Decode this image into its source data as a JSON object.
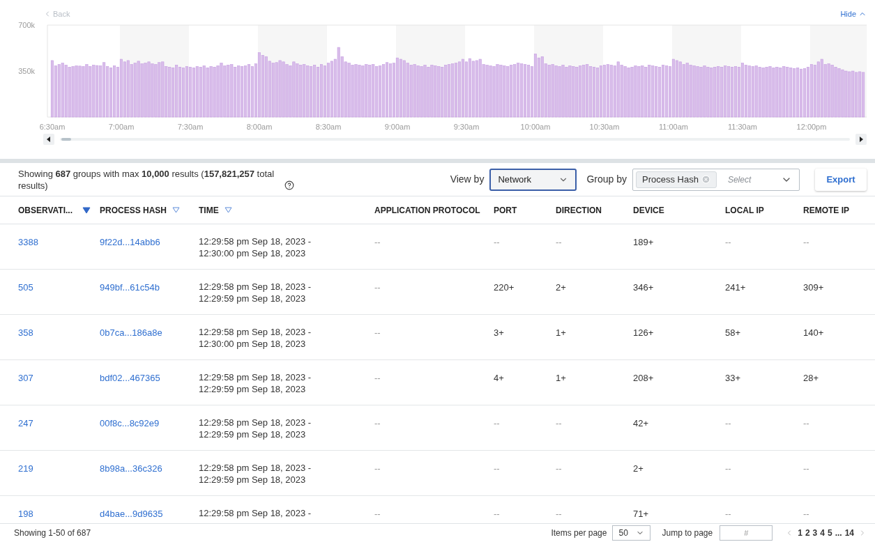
{
  "chart": {
    "back_label": "Back",
    "hide_label": "Hide",
    "chart_data": {
      "type": "bar",
      "ylim": [
        0,
        700
      ],
      "yticks": [
        {
          "value": 350,
          "label": "350k"
        },
        {
          "value": 700,
          "label": "700k"
        }
      ],
      "series": [
        {
          "color": "#d9bdea",
          "values": [
            430,
            390,
            400,
            410,
            395,
            380,
            385,
            390,
            388,
            385,
            400,
            385,
            395,
            392,
            390,
            415,
            385,
            375,
            390,
            380,
            440,
            420,
            430,
            400,
            410,
            425,
            405,
            410,
            420,
            405,
            400,
            415,
            420,
            385,
            380,
            375,
            395,
            380,
            375,
            385,
            380,
            375,
            385,
            380,
            390,
            375,
            385,
            380,
            390,
            410,
            390,
            395,
            400,
            380,
            390,
            385,
            390,
            400,
            385,
            405,
            490,
            470,
            460,
            425,
            410,
            415,
            430,
            420,
            400,
            390,
            420,
            405,
            395,
            400,
            390,
            385,
            395,
            380,
            400,
            390,
            410,
            425,
            440,
            530,
            460,
            420,
            410,
            395,
            400,
            395,
            390,
            400,
            395,
            400,
            385,
            390,
            400,
            415,
            405,
            410,
            450,
            440,
            430,
            410,
            395,
            400,
            390,
            385,
            395,
            380,
            395,
            390,
            385,
            380,
            395,
            400,
            405,
            410,
            420,
            440,
            420,
            445,
            425,
            430,
            440,
            400,
            395,
            390,
            385,
            400,
            395,
            390,
            385,
            395,
            400,
            410,
            405,
            400,
            395,
            385,
            480,
            450,
            460,
            405,
            395,
            400,
            390,
            385,
            395,
            380,
            390,
            385,
            380,
            390,
            395,
            400,
            385,
            380,
            375,
            390,
            395,
            400,
            395,
            390,
            420,
            395,
            385,
            375,
            380,
            390,
            385,
            390,
            380,
            395,
            390,
            385,
            380,
            395,
            390,
            385,
            440,
            430,
            420,
            400,
            410,
            395,
            390,
            385,
            380,
            390,
            380,
            375,
            380,
            385,
            380,
            390,
            385,
            380,
            385,
            380,
            410,
            395,
            390,
            385,
            390,
            380,
            375,
            380,
            385,
            375,
            380,
            375,
            385,
            380,
            375,
            370,
            375,
            365,
            370,
            380,
            400,
            395,
            420,
            440,
            400,
            405,
            395,
            380,
            370,
            360,
            350,
            345,
            350,
            340,
            345,
            340
          ]
        }
      ]
    },
    "x_axis_labels": [
      "6:30am",
      "7:00am",
      "7:30am",
      "8:00am",
      "8:30am",
      "9:00am",
      "9:30am",
      "10:00am",
      "10:30am",
      "11:00am",
      "11:30am",
      "12:00pm"
    ]
  },
  "summary": "Showing **687** groups with max **10,000** results (**157,821,257** total results)",
  "view_by": {
    "label": "View by",
    "value": "Network"
  },
  "group_by": {
    "label": "Group by",
    "chips": [
      "Process Hash"
    ],
    "placeholder": "Select"
  },
  "export_label": "Export",
  "table": {
    "columns": [
      {
        "label": "OBSERVATI...",
        "kind": "link",
        "sorted": true
      },
      {
        "label": "PROCESS HASH",
        "kind": "link",
        "sorted": false
      },
      {
        "label": "TIME",
        "kind": "time",
        "sorted": false
      },
      {
        "label": "APPLICATION PROTOCOL",
        "kind": "text"
      },
      {
        "label": "PORT",
        "kind": "text"
      },
      {
        "label": "DIRECTION",
        "kind": "text"
      },
      {
        "label": "DEVICE",
        "kind": "text"
      },
      {
        "label": "LOCAL IP",
        "kind": "text"
      },
      {
        "label": "REMOTE IP",
        "kind": "text"
      }
    ],
    "rows": [
      {
        "cells": [
          "3388",
          "9f22d...14abb6",
          [
            "12:29:58 pm Sep 18, 2023 -",
            "12:30:00 pm Sep 18, 2023"
          ],
          "--",
          "--",
          "--",
          "189+",
          "--",
          "--"
        ]
      },
      {
        "cells": [
          "505",
          "949bf...61c54b",
          [
            "12:29:58 pm Sep 18, 2023 -",
            "12:29:59 pm Sep 18, 2023"
          ],
          "--",
          "220+",
          "2+",
          "346+",
          "241+",
          "309+"
        ]
      },
      {
        "cells": [
          "358",
          "0b7ca...186a8e",
          [
            "12:29:58 pm Sep 18, 2023 -",
            "12:30:00 pm Sep 18, 2023"
          ],
          "--",
          "3+",
          "1+",
          "126+",
          "58+",
          "140+"
        ]
      },
      {
        "cells": [
          "307",
          "bdf02...467365",
          [
            "12:29:58 pm Sep 18, 2023 -",
            "12:29:59 pm Sep 18, 2023"
          ],
          "--",
          "4+",
          "1+",
          "208+",
          "33+",
          "28+"
        ]
      },
      {
        "cells": [
          "247",
          "00f8c...8c92e9",
          [
            "12:29:58 pm Sep 18, 2023 -",
            "12:29:59 pm Sep 18, 2023"
          ],
          "--",
          "--",
          "--",
          "42+",
          "--",
          "--"
        ]
      },
      {
        "cells": [
          "219",
          "8b98a...36c326",
          [
            "12:29:58 pm Sep 18, 2023 -",
            "12:29:59 pm Sep 18, 2023"
          ],
          "--",
          "--",
          "--",
          "2+",
          "--",
          "--"
        ]
      },
      {
        "cells": [
          "198",
          "d4bae...9d9635",
          [
            "12:29:58 pm Sep 18, 2023 -"
          ],
          "--",
          "--",
          "--",
          "71+",
          "--",
          "--"
        ]
      }
    ]
  },
  "footer": {
    "showing": "Showing 1-50 of 687",
    "items_label": "Items per page",
    "items_value": "50",
    "jump_label": "Jump to page",
    "jump_placeholder": "#",
    "pages": [
      "1",
      "2",
      "3",
      "4",
      "5",
      "...",
      "14"
    ]
  }
}
